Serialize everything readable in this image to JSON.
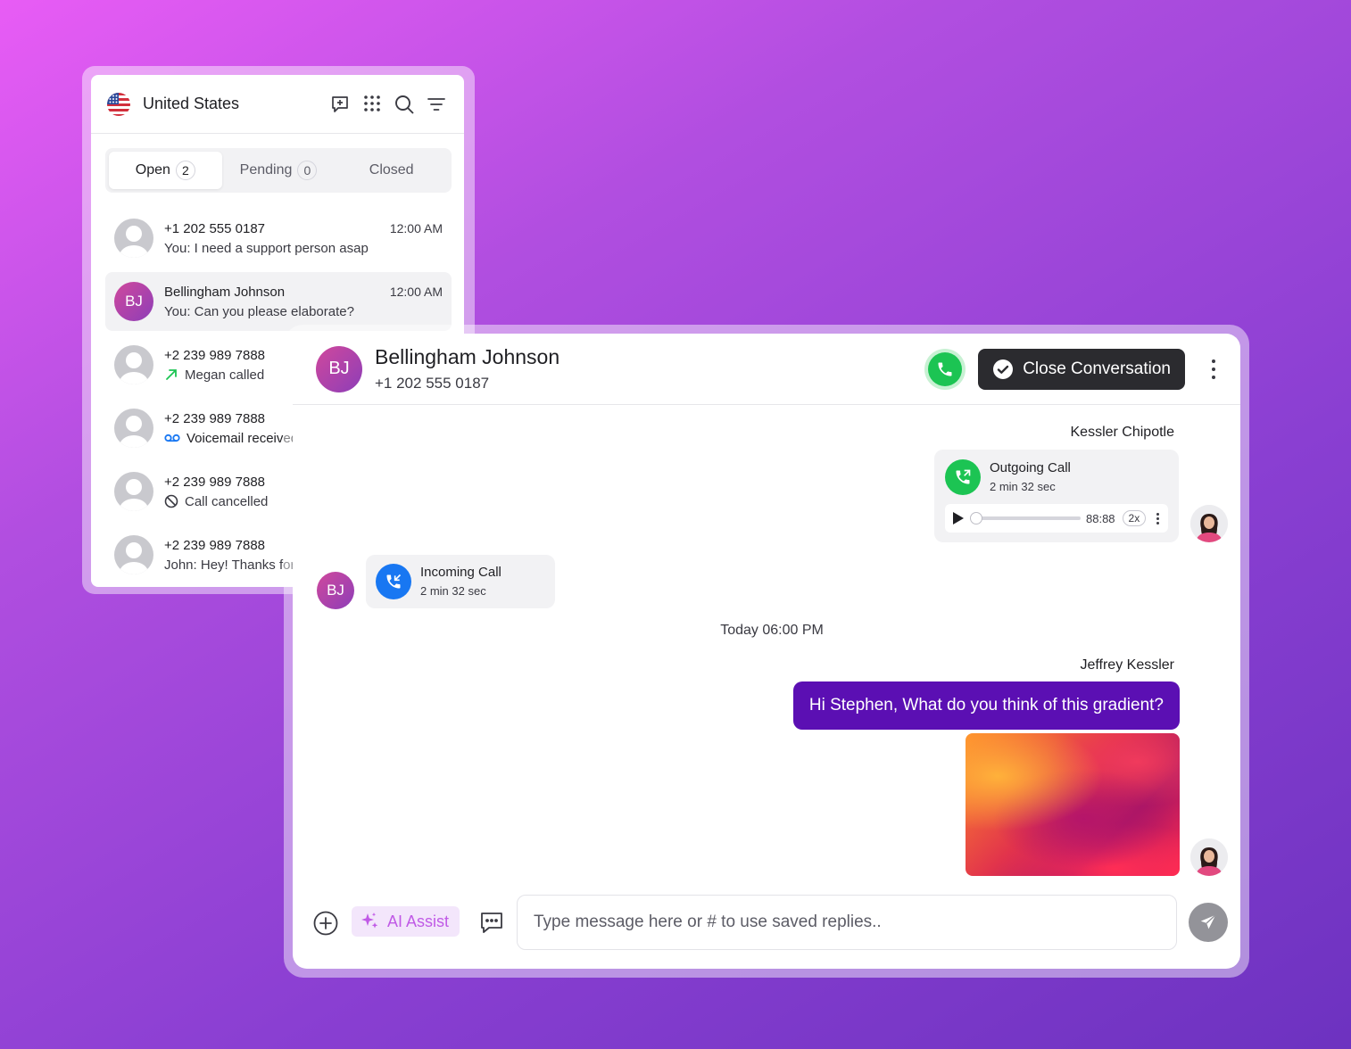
{
  "list_panel": {
    "region": "United States",
    "tabs": [
      {
        "label": "Open",
        "count": "2"
      },
      {
        "label": "Pending",
        "count": "0"
      },
      {
        "label": "Closed",
        "count": ""
      }
    ],
    "conversations": [
      {
        "name": "+1 202 555 0187",
        "time": "12:00 AM",
        "message": "You: I need a support person asap",
        "icon": "none",
        "initials": ""
      },
      {
        "name": "Bellingham Johnson",
        "time": "12:00 AM",
        "message": "You: Can you please elaborate?",
        "icon": "none",
        "initials": "BJ"
      },
      {
        "name": "+2 239 989 7888",
        "time": "",
        "message": "Megan called",
        "icon": "outgoing-arrow-icon",
        "initials": ""
      },
      {
        "name": "+2 239 989 7888",
        "time": "",
        "message": "Voicemail received",
        "icon": "voicemail-icon",
        "initials": ""
      },
      {
        "name": "+2 239 989 7888",
        "time": "",
        "message": "Call cancelled",
        "icon": "cancel-icon",
        "initials": ""
      },
      {
        "name": "+2 239 989 7888",
        "time": "",
        "message": "John: Hey! Thanks for",
        "icon": "none",
        "initials": ""
      }
    ]
  },
  "chat": {
    "contact_initials": "BJ",
    "contact_name": "Bellingham Johnson",
    "contact_phone": "+1 202 555 0187",
    "close_label": "Close Conversation",
    "outgoing": {
      "sender": "Kessler Chipotle",
      "title": "Outgoing Call",
      "duration": "2 min 32 sec",
      "player_time": "88:88",
      "speed": "2x"
    },
    "incoming": {
      "initials": "BJ",
      "title": "Incoming Call",
      "duration": "2 min 32 sec"
    },
    "day_separator": "Today 06:00 PM",
    "message": {
      "sender": "Jeffrey Kessler",
      "text": "Hi Stephen, What do you think of this gradient?"
    },
    "composer": {
      "ai_label": "AI Assist",
      "placeholder": "Type message here or # to use saved replies.."
    }
  },
  "colors": {
    "accent_purple": "#5b0fb3",
    "call_green": "#1cc453",
    "incoming_blue": "#1877f2",
    "ai_pink": "#c05ae6"
  }
}
